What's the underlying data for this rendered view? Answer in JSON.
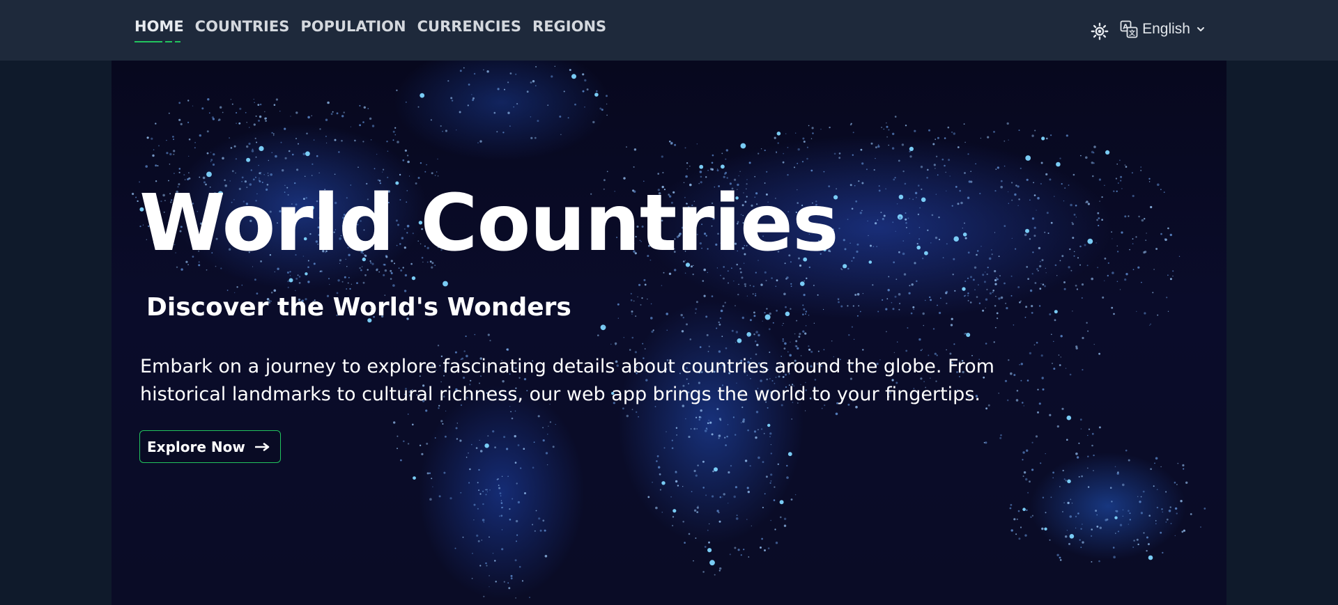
{
  "nav": {
    "items": [
      {
        "label": "HOME",
        "active": true
      },
      {
        "label": "COUNTRIES",
        "active": false
      },
      {
        "label": "POPULATION",
        "active": false
      },
      {
        "label": "CURRENCIES",
        "active": false
      },
      {
        "label": "REGIONS",
        "active": false
      }
    ],
    "language": "English",
    "theme_icon": "sun-icon",
    "language_icon": "translate-icon"
  },
  "hero": {
    "title": "World Countries",
    "subtitle": "Discover the World's Wonders",
    "description": "Embark on a journey to explore fascinating details about countries around the globe. From historical landmarks to cultural richness, our web app brings the world to your fingertips.",
    "cta_label": "Explore Now",
    "background_image": "world map of glowing dots"
  },
  "colors": {
    "nav_bg": "#1e293b",
    "page_bg": "#0f1a2b",
    "accent": "#22c55e",
    "hero_bg": "#0a0c2a"
  }
}
